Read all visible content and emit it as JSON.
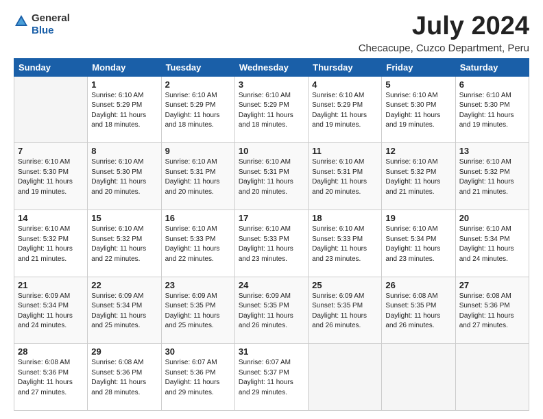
{
  "header": {
    "logo_line1": "General",
    "logo_line2": "Blue",
    "title": "July 2024",
    "subtitle": "Checacupe, Cuzco Department, Peru"
  },
  "weekdays": [
    "Sunday",
    "Monday",
    "Tuesday",
    "Wednesday",
    "Thursday",
    "Friday",
    "Saturday"
  ],
  "weeks": [
    [
      {
        "day": "",
        "sunrise": "",
        "sunset": "",
        "daylight": ""
      },
      {
        "day": "1",
        "sunrise": "Sunrise: 6:10 AM",
        "sunset": "Sunset: 5:29 PM",
        "daylight": "Daylight: 11 hours and 18 minutes."
      },
      {
        "day": "2",
        "sunrise": "Sunrise: 6:10 AM",
        "sunset": "Sunset: 5:29 PM",
        "daylight": "Daylight: 11 hours and 18 minutes."
      },
      {
        "day": "3",
        "sunrise": "Sunrise: 6:10 AM",
        "sunset": "Sunset: 5:29 PM",
        "daylight": "Daylight: 11 hours and 18 minutes."
      },
      {
        "day": "4",
        "sunrise": "Sunrise: 6:10 AM",
        "sunset": "Sunset: 5:29 PM",
        "daylight": "Daylight: 11 hours and 19 minutes."
      },
      {
        "day": "5",
        "sunrise": "Sunrise: 6:10 AM",
        "sunset": "Sunset: 5:30 PM",
        "daylight": "Daylight: 11 hours and 19 minutes."
      },
      {
        "day": "6",
        "sunrise": "Sunrise: 6:10 AM",
        "sunset": "Sunset: 5:30 PM",
        "daylight": "Daylight: 11 hours and 19 minutes."
      }
    ],
    [
      {
        "day": "7",
        "sunrise": "Sunrise: 6:10 AM",
        "sunset": "Sunset: 5:30 PM",
        "daylight": "Daylight: 11 hours and 19 minutes."
      },
      {
        "day": "8",
        "sunrise": "Sunrise: 6:10 AM",
        "sunset": "Sunset: 5:30 PM",
        "daylight": "Daylight: 11 hours and 20 minutes."
      },
      {
        "day": "9",
        "sunrise": "Sunrise: 6:10 AM",
        "sunset": "Sunset: 5:31 PM",
        "daylight": "Daylight: 11 hours and 20 minutes."
      },
      {
        "day": "10",
        "sunrise": "Sunrise: 6:10 AM",
        "sunset": "Sunset: 5:31 PM",
        "daylight": "Daylight: 11 hours and 20 minutes."
      },
      {
        "day": "11",
        "sunrise": "Sunrise: 6:10 AM",
        "sunset": "Sunset: 5:31 PM",
        "daylight": "Daylight: 11 hours and 20 minutes."
      },
      {
        "day": "12",
        "sunrise": "Sunrise: 6:10 AM",
        "sunset": "Sunset: 5:32 PM",
        "daylight": "Daylight: 11 hours and 21 minutes."
      },
      {
        "day": "13",
        "sunrise": "Sunrise: 6:10 AM",
        "sunset": "Sunset: 5:32 PM",
        "daylight": "Daylight: 11 hours and 21 minutes."
      }
    ],
    [
      {
        "day": "14",
        "sunrise": "Sunrise: 6:10 AM",
        "sunset": "Sunset: 5:32 PM",
        "daylight": "Daylight: 11 hours and 21 minutes."
      },
      {
        "day": "15",
        "sunrise": "Sunrise: 6:10 AM",
        "sunset": "Sunset: 5:32 PM",
        "daylight": "Daylight: 11 hours and 22 minutes."
      },
      {
        "day": "16",
        "sunrise": "Sunrise: 6:10 AM",
        "sunset": "Sunset: 5:33 PM",
        "daylight": "Daylight: 11 hours and 22 minutes."
      },
      {
        "day": "17",
        "sunrise": "Sunrise: 6:10 AM",
        "sunset": "Sunset: 5:33 PM",
        "daylight": "Daylight: 11 hours and 23 minutes."
      },
      {
        "day": "18",
        "sunrise": "Sunrise: 6:10 AM",
        "sunset": "Sunset: 5:33 PM",
        "daylight": "Daylight: 11 hours and 23 minutes."
      },
      {
        "day": "19",
        "sunrise": "Sunrise: 6:10 AM",
        "sunset": "Sunset: 5:34 PM",
        "daylight": "Daylight: 11 hours and 23 minutes."
      },
      {
        "day": "20",
        "sunrise": "Sunrise: 6:10 AM",
        "sunset": "Sunset: 5:34 PM",
        "daylight": "Daylight: 11 hours and 24 minutes."
      }
    ],
    [
      {
        "day": "21",
        "sunrise": "Sunrise: 6:09 AM",
        "sunset": "Sunset: 5:34 PM",
        "daylight": "Daylight: 11 hours and 24 minutes."
      },
      {
        "day": "22",
        "sunrise": "Sunrise: 6:09 AM",
        "sunset": "Sunset: 5:34 PM",
        "daylight": "Daylight: 11 hours and 25 minutes."
      },
      {
        "day": "23",
        "sunrise": "Sunrise: 6:09 AM",
        "sunset": "Sunset: 5:35 PM",
        "daylight": "Daylight: 11 hours and 25 minutes."
      },
      {
        "day": "24",
        "sunrise": "Sunrise: 6:09 AM",
        "sunset": "Sunset: 5:35 PM",
        "daylight": "Daylight: 11 hours and 26 minutes."
      },
      {
        "day": "25",
        "sunrise": "Sunrise: 6:09 AM",
        "sunset": "Sunset: 5:35 PM",
        "daylight": "Daylight: 11 hours and 26 minutes."
      },
      {
        "day": "26",
        "sunrise": "Sunrise: 6:08 AM",
        "sunset": "Sunset: 5:35 PM",
        "daylight": "Daylight: 11 hours and 26 minutes."
      },
      {
        "day": "27",
        "sunrise": "Sunrise: 6:08 AM",
        "sunset": "Sunset: 5:36 PM",
        "daylight": "Daylight: 11 hours and 27 minutes."
      }
    ],
    [
      {
        "day": "28",
        "sunrise": "Sunrise: 6:08 AM",
        "sunset": "Sunset: 5:36 PM",
        "daylight": "Daylight: 11 hours and 27 minutes."
      },
      {
        "day": "29",
        "sunrise": "Sunrise: 6:08 AM",
        "sunset": "Sunset: 5:36 PM",
        "daylight": "Daylight: 11 hours and 28 minutes."
      },
      {
        "day": "30",
        "sunrise": "Sunrise: 6:07 AM",
        "sunset": "Sunset: 5:36 PM",
        "daylight": "Daylight: 11 hours and 29 minutes."
      },
      {
        "day": "31",
        "sunrise": "Sunrise: 6:07 AM",
        "sunset": "Sunset: 5:37 PM",
        "daylight": "Daylight: 11 hours and 29 minutes."
      },
      {
        "day": "",
        "sunrise": "",
        "sunset": "",
        "daylight": ""
      },
      {
        "day": "",
        "sunrise": "",
        "sunset": "",
        "daylight": ""
      },
      {
        "day": "",
        "sunrise": "",
        "sunset": "",
        "daylight": ""
      }
    ]
  ]
}
